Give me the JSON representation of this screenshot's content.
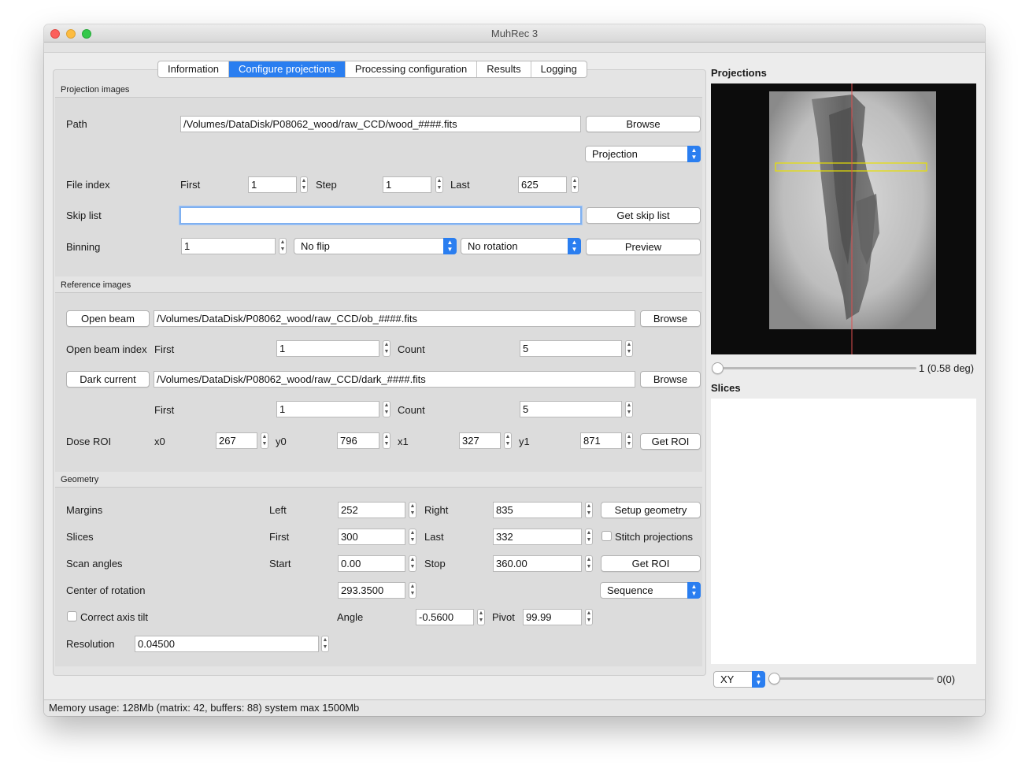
{
  "window": {
    "title": "MuhRec 3"
  },
  "tabs": [
    "Information",
    "Configure projections",
    "Processing configuration",
    "Results",
    "Logging"
  ],
  "projection_images": {
    "group_title": "Projection images",
    "path_label": "Path",
    "path_value": "/Volumes/DataDisk/P08062_wood/raw_CCD/wood_####.fits",
    "browse_label": "Browse",
    "type_select": "Projection",
    "file_index_label": "File index",
    "first_label": "First",
    "first_value": "1",
    "step_label": "Step",
    "step_value": "1",
    "last_label": "Last",
    "last_value": "625",
    "skip_list_label": "Skip list",
    "skip_list_value": "",
    "get_skip_list_label": "Get skip list",
    "binning_label": "Binning",
    "binning_value": "1",
    "flip_select": "No flip",
    "rotation_select": "No rotation",
    "preview_label": "Preview"
  },
  "reference_images": {
    "group_title": "Reference images",
    "open_beam_button": "Open beam",
    "open_beam_path": "/Volumes/DataDisk/P08062_wood/raw_CCD/ob_####.fits",
    "browse_label": "Browse",
    "open_beam_index_label": "Open beam index",
    "first_label": "First",
    "ob_first": "1",
    "count_label": "Count",
    "ob_count": "5",
    "dark_current_button": "Dark current",
    "dark_path": "/Volumes/DataDisk/P08062_wood/raw_CCD/dark_####.fits",
    "dc_first": "1",
    "dc_count": "5",
    "dose_roi_label": "Dose ROI",
    "x0_label": "x0",
    "x0": "267",
    "y0_label": "y0",
    "y0": "796",
    "x1_label": "x1",
    "x1": "327",
    "y1_label": "y1",
    "y1": "871",
    "get_roi_label": "Get ROI"
  },
  "geometry": {
    "group_title": "Geometry",
    "margins_label": "Margins",
    "left_label": "Left",
    "left": "252",
    "right_label": "Right",
    "right": "835",
    "setup_geometry_label": "Setup geometry",
    "slices_label": "Slices",
    "first_label": "First",
    "first": "300",
    "last_label": "Last",
    "last": "332",
    "stitch_label": "Stitch projections",
    "scan_angles_label": "Scan angles",
    "start_label": "Start",
    "start": "0.00",
    "stop_label": "Stop",
    "stop": "360.00",
    "get_roi_label": "Get ROI",
    "center_label": "Center of rotation",
    "center": "293.3500",
    "sequence_select": "Sequence",
    "correct_tilt_label": "Correct axis tilt",
    "angle_label": "Angle",
    "angle": "-0.5600",
    "pivot_label": "Pivot",
    "pivot": "99.99",
    "resolution_label": "Resolution",
    "resolution": "0.04500"
  },
  "right_panel": {
    "projections_title": "Projections",
    "projection_slider_value": "1 (0.58 deg)",
    "slices_title": "Slices",
    "plane_select": "XY",
    "slice_slider_value": "0(0)"
  },
  "status": {
    "memory": "Memory usage: 128Mb (matrix: 42, buffers: 88) system max 1500Mb"
  },
  "colors": {
    "accent": "#2a7ef0",
    "roi_box": "#e8e000",
    "axis_line": "#e05050"
  }
}
